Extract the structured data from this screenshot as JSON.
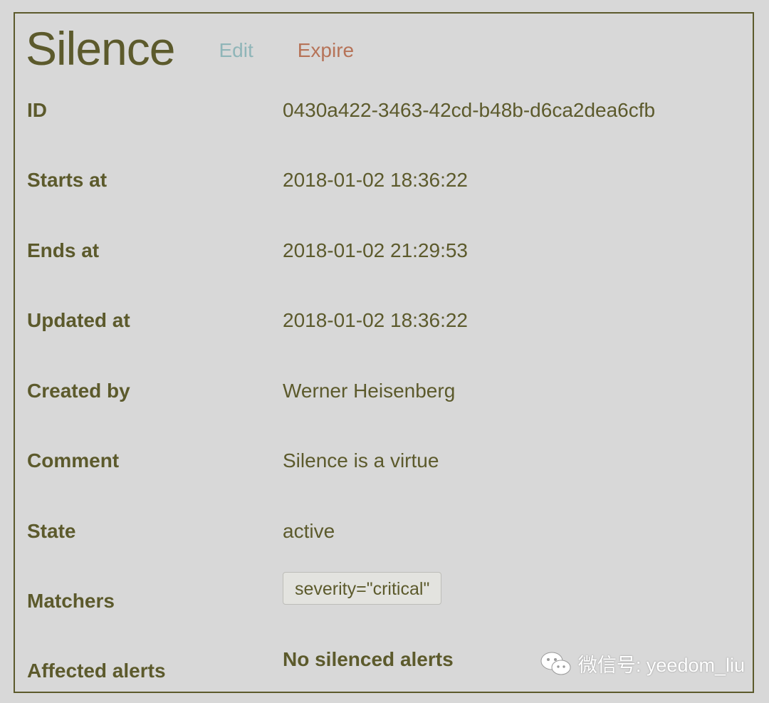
{
  "header": {
    "title": "Silence",
    "edit_label": "Edit",
    "expire_label": "Expire"
  },
  "fields": {
    "id": {
      "label": "ID",
      "value": "0430a422-3463-42cd-b48b-d6ca2dea6cfb"
    },
    "starts_at": {
      "label": "Starts at",
      "value": "2018-01-02 18:36:22"
    },
    "ends_at": {
      "label": "Ends at",
      "value": "2018-01-02 21:29:53"
    },
    "updated_at": {
      "label": "Updated at",
      "value": "2018-01-02 18:36:22"
    },
    "created_by": {
      "label": "Created by",
      "value": "Werner Heisenberg"
    },
    "comment": {
      "label": "Comment",
      "value": "Silence is a virtue"
    },
    "state": {
      "label": "State",
      "value": "active"
    },
    "matchers": {
      "label": "Matchers",
      "items": [
        "severity=\"critical\""
      ]
    },
    "affected_alerts": {
      "label": "Affected alerts",
      "value": "No silenced alerts"
    }
  },
  "watermark": {
    "text": "微信号: yeedom_liu",
    "icon": "wechat-icon"
  },
  "colors": {
    "text": "#5c5a2c",
    "edit": "#8fb5b8",
    "expire": "#b67358",
    "background": "#d8d8d8",
    "border": "#5c5a2c"
  }
}
